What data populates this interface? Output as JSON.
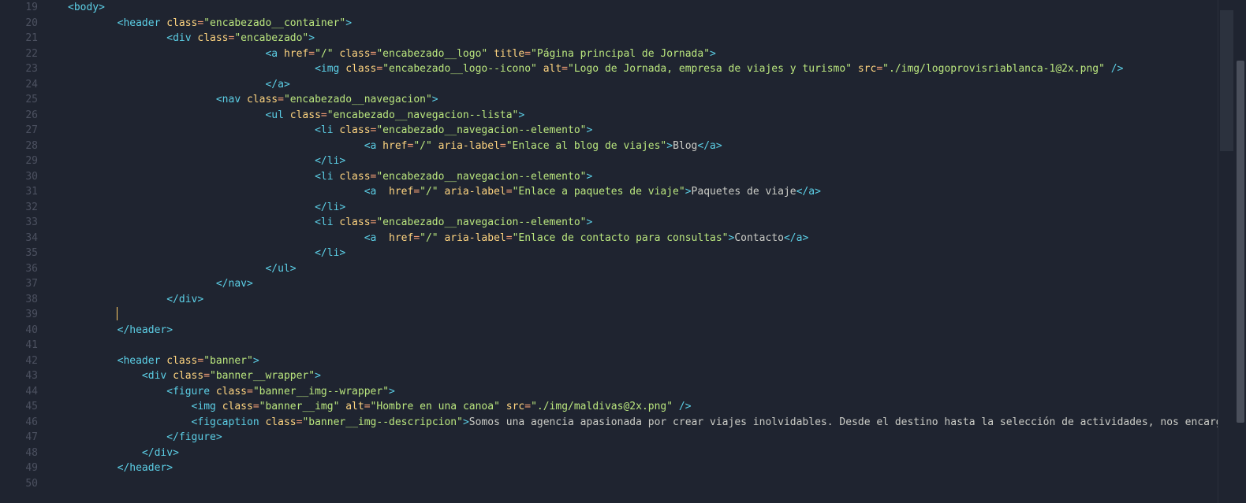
{
  "first_line_number": 19,
  "indent_unit": "    ",
  "cursor": {
    "line_index": 20,
    "indent": 2
  },
  "minimap": {
    "top_pct": 2,
    "height_pct": 28
  },
  "scrollbar": {
    "top_pct": 12,
    "height_pct": 72
  },
  "lines": [
    {
      "i": 0,
      "t": "open",
      "tag": "body",
      "attrs": []
    },
    {
      "i": 2,
      "t": "open",
      "tag": "header",
      "attrs": [
        [
          "class",
          "encabezado__container"
        ]
      ]
    },
    {
      "i": 4,
      "t": "open",
      "tag": "div",
      "attrs": [
        [
          "class",
          "encabezado"
        ]
      ]
    },
    {
      "i": 8,
      "t": "open",
      "tag": "a",
      "attrs": [
        [
          "href",
          "/"
        ],
        [
          "class",
          "encabezado__logo"
        ],
        [
          "title",
          "Página principal de Jornada"
        ]
      ]
    },
    {
      "i": 10,
      "t": "selfclose",
      "tag": "img",
      "attrs": [
        [
          "class",
          "encabezado__logo--icono"
        ],
        [
          "alt",
          "Logo de Jornada, empresa de viajes y turismo"
        ],
        [
          "src",
          "./img/logoprovisriablanca-1@2x.png"
        ]
      ]
    },
    {
      "i": 8,
      "t": "close",
      "tag": "a"
    },
    {
      "i": 6,
      "t": "open",
      "tag": "nav",
      "attrs": [
        [
          "class",
          "encabezado__navegacion"
        ]
      ]
    },
    {
      "i": 8,
      "t": "open",
      "tag": "ul",
      "attrs": [
        [
          "class",
          "encabezado__navegacion--lista"
        ]
      ]
    },
    {
      "i": 10,
      "t": "open",
      "tag": "li",
      "attrs": [
        [
          "class",
          "encabezado__navegacion--elemento"
        ]
      ]
    },
    {
      "i": 12,
      "t": "wraptext",
      "tag": "a",
      "attrs": [
        [
          "href",
          "/"
        ],
        [
          "aria-label",
          "Enlace al blog de viajes"
        ]
      ],
      "text": "Blog"
    },
    {
      "i": 10,
      "t": "close",
      "tag": "li"
    },
    {
      "i": 10,
      "t": "open",
      "tag": "li",
      "attrs": [
        [
          "class",
          "encabezado__navegacion--elemento"
        ]
      ]
    },
    {
      "i": 12,
      "t": "wraptext",
      "tag": "a",
      "attrs": [
        [
          "href",
          "/"
        ],
        [
          "aria-label",
          "Enlace a paquetes de viaje"
        ]
      ],
      "text": "Paquetes de viaje",
      "space_after_tag": true
    },
    {
      "i": 10,
      "t": "close",
      "tag": "li"
    },
    {
      "i": 10,
      "t": "open",
      "tag": "li",
      "attrs": [
        [
          "class",
          "encabezado__navegacion--elemento"
        ]
      ]
    },
    {
      "i": 12,
      "t": "wraptext",
      "tag": "a",
      "attrs": [
        [
          "href",
          "/"
        ],
        [
          "aria-label",
          "Enlace de contacto para consultas"
        ]
      ],
      "text": "Contacto",
      "space_after_tag": true
    },
    {
      "i": 10,
      "t": "close",
      "tag": "li"
    },
    {
      "i": 8,
      "t": "close",
      "tag": "ul"
    },
    {
      "i": 6,
      "t": "close",
      "tag": "nav"
    },
    {
      "i": 4,
      "t": "close",
      "tag": "div"
    },
    {
      "i": 2,
      "t": "cursor"
    },
    {
      "i": 2,
      "t": "close",
      "tag": "header"
    },
    {
      "i": 0,
      "t": "blank"
    },
    {
      "i": 2,
      "t": "open",
      "tag": "header",
      "attrs": [
        [
          "class",
          "banner"
        ]
      ]
    },
    {
      "i": 3,
      "t": "open",
      "tag": "div",
      "attrs": [
        [
          "class",
          "banner__wrapper"
        ]
      ]
    },
    {
      "i": 4,
      "t": "open",
      "tag": "figure",
      "attrs": [
        [
          "class",
          "banner__img--wrapper"
        ]
      ]
    },
    {
      "i": 5,
      "t": "selfclose",
      "tag": "img",
      "attrs": [
        [
          "class",
          "banner__img"
        ],
        [
          "alt",
          "Hombre en una canoa"
        ],
        [
          "src",
          "./img/maldivas@2x.png"
        ]
      ]
    },
    {
      "i": 5,
      "t": "wraptext",
      "tag": "figcaption",
      "attrs": [
        [
          "class",
          "banner__img--descripcion"
        ]
      ],
      "text": "Somos una agencia apasionada por crear viajes inolvidables. Desde el destino hasta la selección de actividades, nos encargamos de todos los d",
      "no_close": true
    },
    {
      "i": 4,
      "t": "close",
      "tag": "figure"
    },
    {
      "i": 3,
      "t": "close",
      "tag": "div"
    },
    {
      "i": 2,
      "t": "close",
      "tag": "header"
    },
    {
      "i": 0,
      "t": "blank"
    }
  ]
}
